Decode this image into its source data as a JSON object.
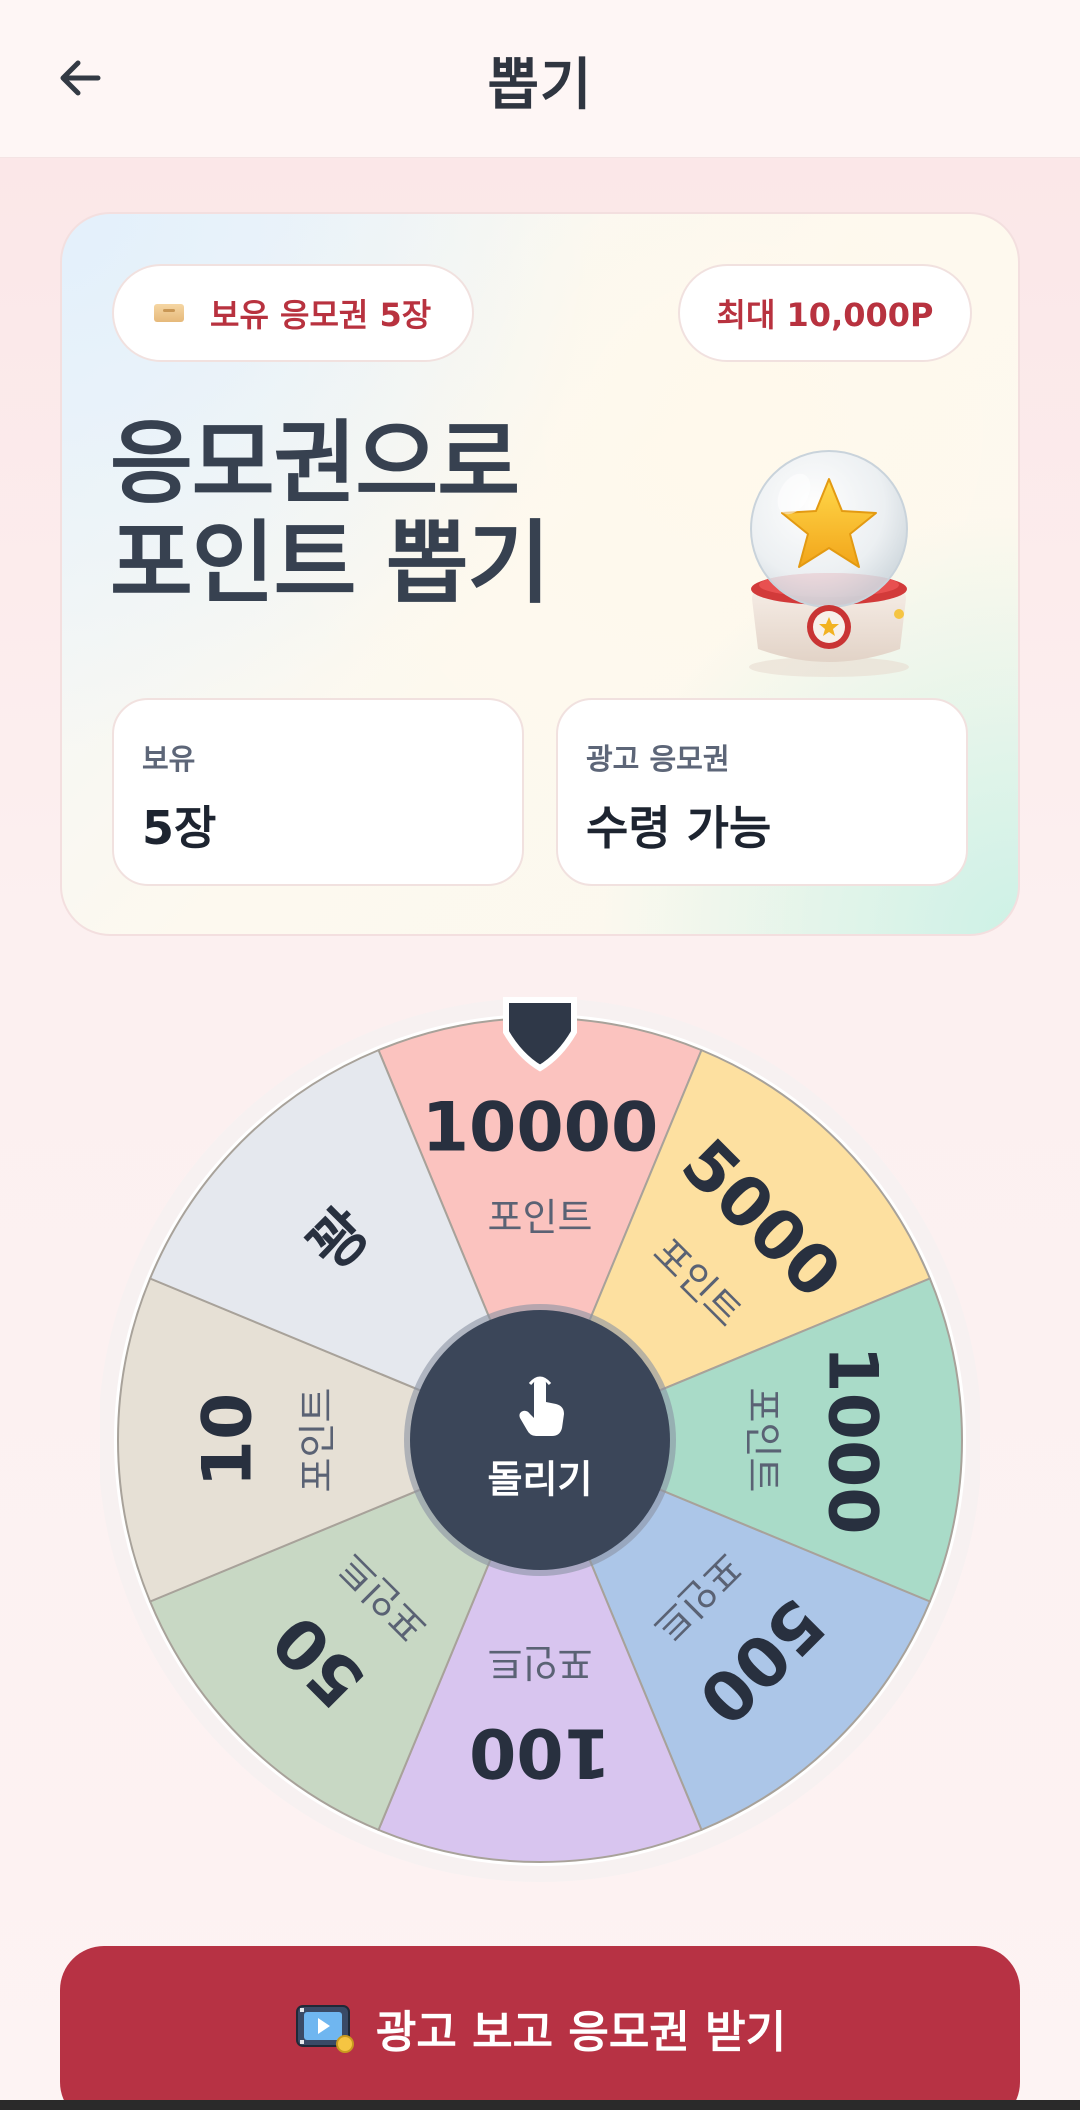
{
  "header": {
    "title": "뽑기",
    "back_icon": "arrow-left-icon"
  },
  "hero": {
    "tickets_pill": "보유 응모권 5장",
    "max_pill": "최대 10,000P",
    "title_line1": "응모권으로",
    "title_line2": "포인트 뽑기",
    "stats": [
      {
        "label": "보유",
        "value": "5장"
      },
      {
        "label": "광고 응모권",
        "value": "수령 가능"
      }
    ]
  },
  "wheel": {
    "spin_label": "돌리기",
    "spin_icon": "tap-hand-icon",
    "unit_label": "포인트",
    "segments": [
      {
        "value": "10000",
        "unit": "포인트",
        "color": "#fbc3bf"
      },
      {
        "value": "5000",
        "unit": "포인트",
        "color": "#fde0a0"
      },
      {
        "value": "1000",
        "unit": "포인트",
        "color": "#a9dbc8"
      },
      {
        "value": "500",
        "unit": "포인트",
        "color": "#acc6e8"
      },
      {
        "value": "100",
        "unit": "포인트",
        "color": "#d8c5ef"
      },
      {
        "value": "50",
        "unit": "포인트",
        "color": "#c8d8c4"
      },
      {
        "value": "10",
        "unit": "포인트",
        "color": "#e6e0d5"
      },
      {
        "value": "꽝",
        "unit": "",
        "color": "#e5e8ee"
      }
    ]
  },
  "cta": {
    "label": "광고 보고 응모권 받기",
    "icon": "video-ad-icon"
  },
  "colors": {
    "accent": "#b73244",
    "text_dark": "#2f3540"
  }
}
